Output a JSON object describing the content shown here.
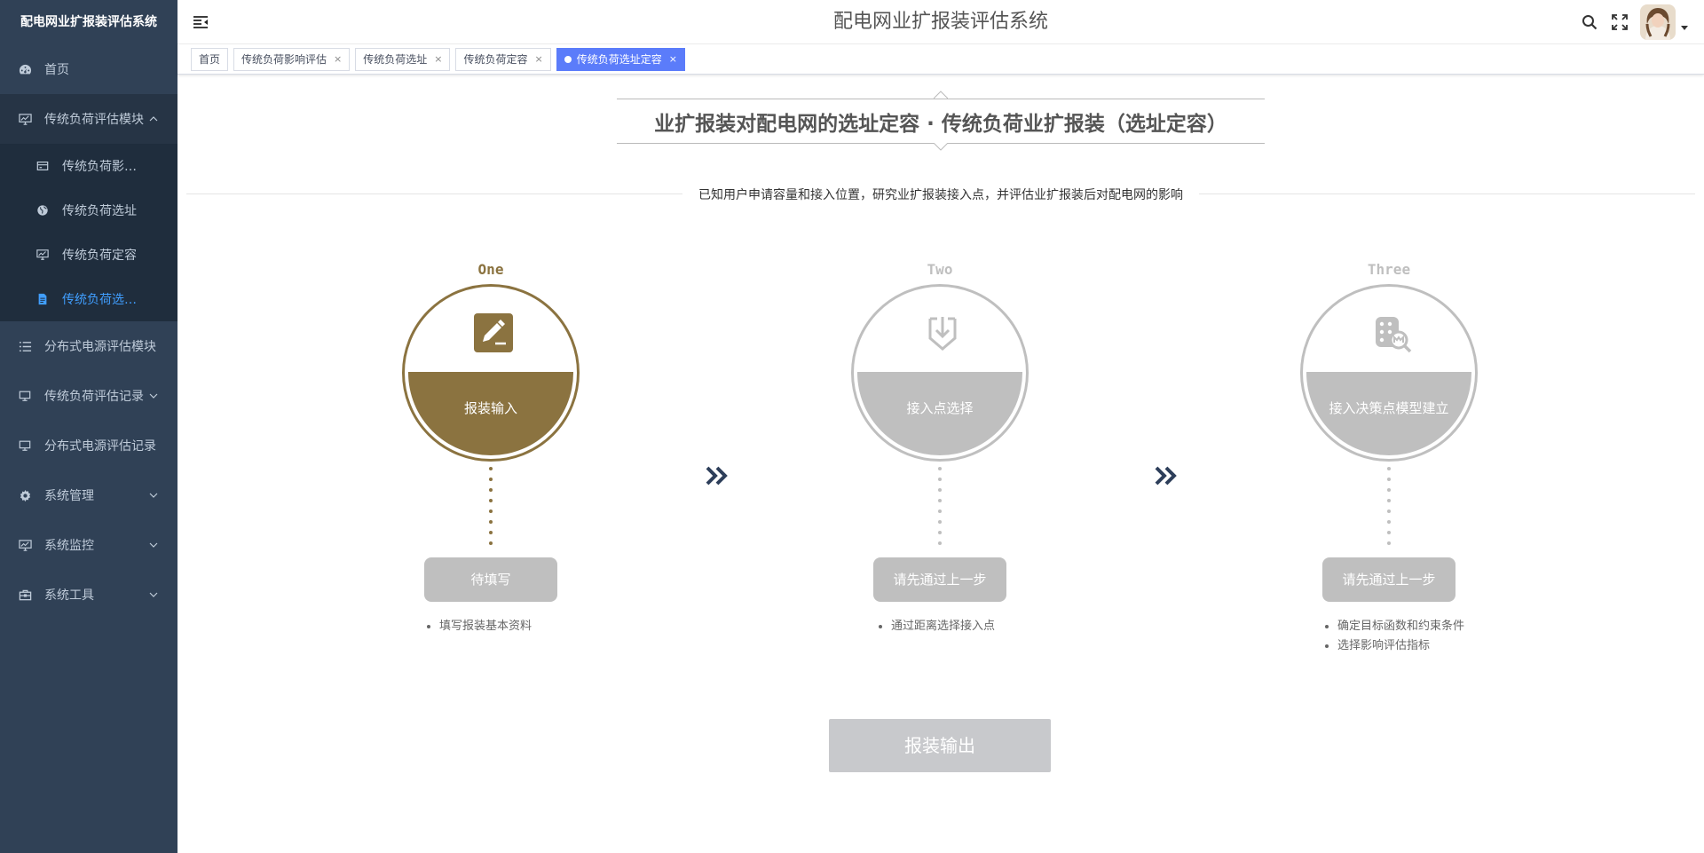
{
  "sidebar": {
    "brand": "配电网业扩报装评估系统",
    "items": [
      {
        "label": "首页"
      },
      {
        "label": "传统负荷评估模块"
      },
      {
        "label": "传统负荷影…"
      },
      {
        "label": "传统负荷选址"
      },
      {
        "label": "传统负荷定容"
      },
      {
        "label": "传统负荷选…"
      },
      {
        "label": "分布式电源评估模块"
      },
      {
        "label": "传统负荷评估记录"
      },
      {
        "label": "分布式电源评估记录"
      },
      {
        "label": "系统管理"
      },
      {
        "label": "系统监控"
      },
      {
        "label": "系统工具"
      }
    ]
  },
  "navbar": {
    "title": "配电网业扩报装评估系统"
  },
  "tags": [
    {
      "label": "首页",
      "closable": false
    },
    {
      "label": "传统负荷影响评估",
      "closable": true
    },
    {
      "label": "传统负荷选址",
      "closable": true
    },
    {
      "label": "传统负荷定容",
      "closable": true
    },
    {
      "label": "传统负荷选址定容",
      "closable": true,
      "active": true
    }
  ],
  "tag_close": "×",
  "page": {
    "heading": "业扩报装对配电网的选址定容 · 传统负荷业扩报装（选址定容）",
    "subtitle": "已知用户申请容量和接入位置，研究业扩报装接入点，并评估业扩报装后对配电网的影响",
    "steps": [
      {
        "label": "One",
        "title": "报装输入",
        "status": "待填写",
        "bullets": [
          "填写报装基本资料"
        ],
        "icon": "edit-icon",
        "color": "#8b7340"
      },
      {
        "label": "Two",
        "title": "接入点选择",
        "status": "请先通过上一步",
        "bullets": [
          "通过距离选择接入点"
        ],
        "icon": "download-shield-icon",
        "color": "#bfbfbf"
      },
      {
        "label": "Three",
        "title": "接入决策点模型建立",
        "status": "请先通过上一步",
        "bullets": [
          "确定目标函数和约束条件",
          "选择影响评估指标"
        ],
        "icon": "building-search-icon",
        "color": "#bfbfbf"
      }
    ],
    "output_button": "报装输出"
  },
  "colors": {
    "sidebar_bg": "#304156",
    "submenu_bg": "#1f2d3d",
    "active_menu": "#409eff",
    "active_tag": "#5b7cfa",
    "step_active": "#8b7340",
    "step_inactive": "#bfbfbf",
    "arrow": "#2d3e5a"
  }
}
